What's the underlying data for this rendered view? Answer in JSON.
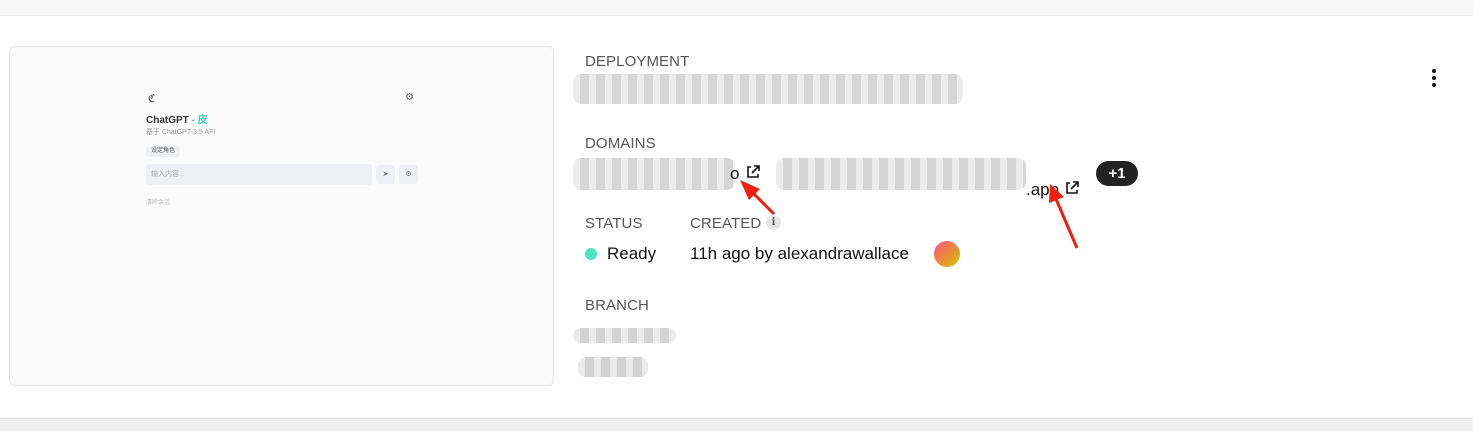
{
  "preview": {
    "logo": "ℭ",
    "gear": "⚙",
    "title_main": "ChatGPT",
    "title_sep": " - ",
    "title_accent": "皮",
    "subtitle": "基于 ChatGPT-3.5 API",
    "role_button": "设定角色",
    "input_placeholder": "输入内容...",
    "send_icon": "➤",
    "clear_icon": "⚙",
    "hint": "清除会话"
  },
  "deployment": {
    "label": "DEPLOYMENT"
  },
  "domains": {
    "label": "DOMAINS",
    "domain1_suffix": "o",
    "domain2_suffix": ".app",
    "more_badge": "+1"
  },
  "status": {
    "label": "STATUS",
    "value": "Ready",
    "color": "#50e3c2"
  },
  "created": {
    "label": "CREATED",
    "info_icon": "i",
    "value": "11h ago by alexandrawallace"
  },
  "branch": {
    "label": "BRANCH"
  },
  "icons": {
    "external_link": "external-link-icon",
    "more_menu": "kebab-icon"
  },
  "colors": {
    "annotation_arrow": "#f02010",
    "badge_bg": "#222222"
  }
}
